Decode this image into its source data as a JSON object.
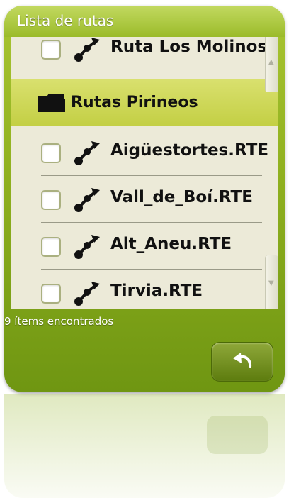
{
  "window": {
    "title": "Lista de rutas"
  },
  "list": {
    "rows": [
      {
        "kind": "route",
        "label": "Ruta Los Molinos.",
        "checked": false
      },
      {
        "kind": "folder",
        "label": "Rutas Pirineos"
      },
      {
        "kind": "route",
        "label": "Aigüestortes.RTE",
        "checked": false
      },
      {
        "kind": "route",
        "label": "Vall_de_Boí.RTE",
        "checked": false
      },
      {
        "kind": "route",
        "label": "Alt_Aneu.RTE",
        "checked": false
      },
      {
        "kind": "route",
        "label": "Tirvia.RTE",
        "checked": false
      }
    ]
  },
  "status": {
    "text": "9 ítems encontrados"
  },
  "icons": {
    "route": "route-icon",
    "folder": "folder-icon",
    "back": "undo-arrow-icon",
    "scroll_up": "arrow-up-icon",
    "scroll_down": "arrow-down-icon"
  },
  "colors": {
    "frame_green": "#8fb01f",
    "list_background": "#ecead8",
    "folder_highlight": "#cdd64e",
    "button_green": "#6f8a1c"
  }
}
